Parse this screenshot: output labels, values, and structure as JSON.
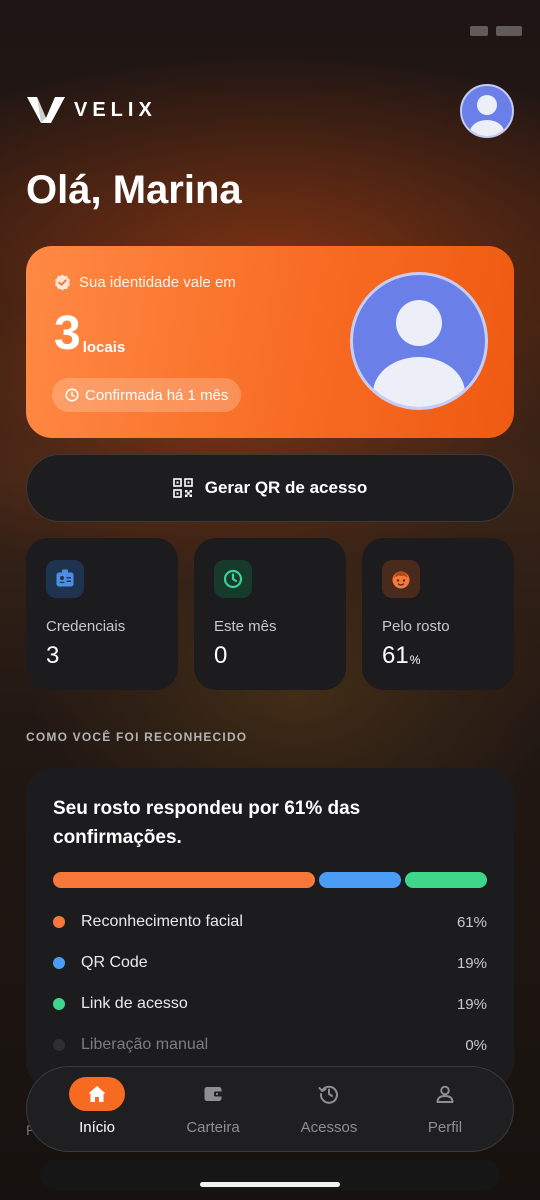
{
  "brand": {
    "name": "VELIX"
  },
  "greeting": "Olá, Marina",
  "identity_card": {
    "label": "Sua identidade vale em",
    "count": "3",
    "count_unit": "locais",
    "confirmed": "Confirmada há 1 mês"
  },
  "qr_button": {
    "label": "Gerar QR de acesso"
  },
  "stats": [
    {
      "label": "Credenciais",
      "value": "3",
      "unit": "",
      "icon": "id-card-icon",
      "color": "#4a90e2"
    },
    {
      "label": "Este mês",
      "value": "0",
      "unit": "",
      "icon": "clock-icon",
      "color": "#34d399"
    },
    {
      "label": "Pelo rosto",
      "value": "61",
      "unit": "%",
      "icon": "face-icon",
      "color": "#f76a22"
    }
  ],
  "section_title": "COMO VOCÊ FOI RECONHECIDO",
  "recognition": {
    "headline": "Seu rosto respondeu por 61% das confirmações.",
    "methods": [
      {
        "name": "Reconhecimento facial",
        "percent": "61%",
        "share": 61,
        "color": "#f7793a"
      },
      {
        "name": "QR Code",
        "percent": "19%",
        "share": 19,
        "color": "#4b9cf5"
      },
      {
        "name": "Link de acesso",
        "percent": "19%",
        "share": 19,
        "color": "#3ed68b"
      },
      {
        "name": "Liberação manual",
        "percent": "0%",
        "share": 0,
        "color": "#2f2f31"
      }
    ]
  },
  "tabbar": {
    "active": "inicio",
    "items": [
      {
        "id": "inicio",
        "label": "Início",
        "icon": "home-icon"
      },
      {
        "id": "carteira",
        "label": "Carteira",
        "icon": "wallet-icon"
      },
      {
        "id": "acessos",
        "label": "Acessos",
        "icon": "history-icon"
      },
      {
        "id": "perfil",
        "label": "Perfil",
        "icon": "user-icon"
      }
    ]
  },
  "colors": {
    "accent": "#f76a22",
    "card_bg": "#1c1c1e",
    "avatar_bg": "#6b7fe8"
  }
}
